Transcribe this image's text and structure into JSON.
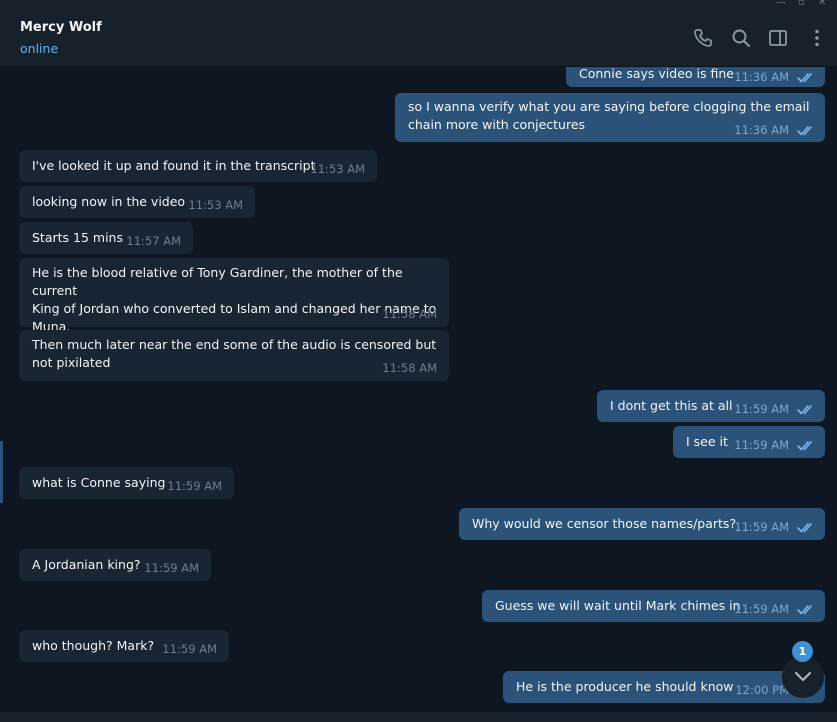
{
  "header": {
    "name": "Mercy Wolf",
    "status": "online"
  },
  "messages": [
    {
      "dir": "out",
      "text": "Connie says video is fine",
      "time": "11:36 AM"
    },
    {
      "dir": "out",
      "text": "so I wanna verify what you are saying before clogging the email\nchain more with conjectures",
      "time": "11:36 AM"
    },
    {
      "dir": "in",
      "text": "I've looked it up and found it in the transcript",
      "time": "11:53 AM"
    },
    {
      "dir": "in",
      "text": "looking now in the video",
      "time": "11:53 AM"
    },
    {
      "dir": "in",
      "text": "Starts 15 mins",
      "time": "11:57 AM"
    },
    {
      "dir": "in",
      "text": "He is the blood relative of Tony Gardiner, the mother of the current\nKing of Jordan who converted to Islam and changed her name to\nMuna.",
      "time": "11:58 AM"
    },
    {
      "dir": "in",
      "text": "Then much later near the end some of the audio is censored but\nnot pixilated",
      "time": "11:58 AM"
    },
    {
      "dir": "out",
      "text": "I dont get this at all",
      "time": "11:59 AM"
    },
    {
      "dir": "out",
      "text": "I see it",
      "time": "11:59 AM"
    },
    {
      "dir": "in",
      "text": "what is Conne saying",
      "time": "11:59 AM"
    },
    {
      "dir": "out",
      "text": "Why would we censor those names/parts?",
      "time": "11:59 AM"
    },
    {
      "dir": "in",
      "text": "A Jordanian king?",
      "time": "11:59 AM"
    },
    {
      "dir": "out",
      "text": "Guess we will wait until Mark chimes in",
      "time": "11:59 AM"
    },
    {
      "dir": "in",
      "text": "who though? Mark?",
      "time": "11:59 AM"
    },
    {
      "dir": "out",
      "text": "He is the producer he should know",
      "time": "12:00 PM"
    }
  ],
  "unread_count": "1",
  "icons": {
    "call": "phone-icon",
    "search": "search-icon",
    "sidebar": "sidebar-toggle-icon",
    "menu": "more-vertical-icon",
    "read": "double-check-icon",
    "scroll": "chevron-down-icon"
  },
  "colors": {
    "background": "#0e1621",
    "header": "#17212b",
    "incoming_bubble": "#182533",
    "outgoing_bubble": "#2b5278",
    "accent": "#5eb5f7",
    "badge": "#3e8fd3"
  }
}
